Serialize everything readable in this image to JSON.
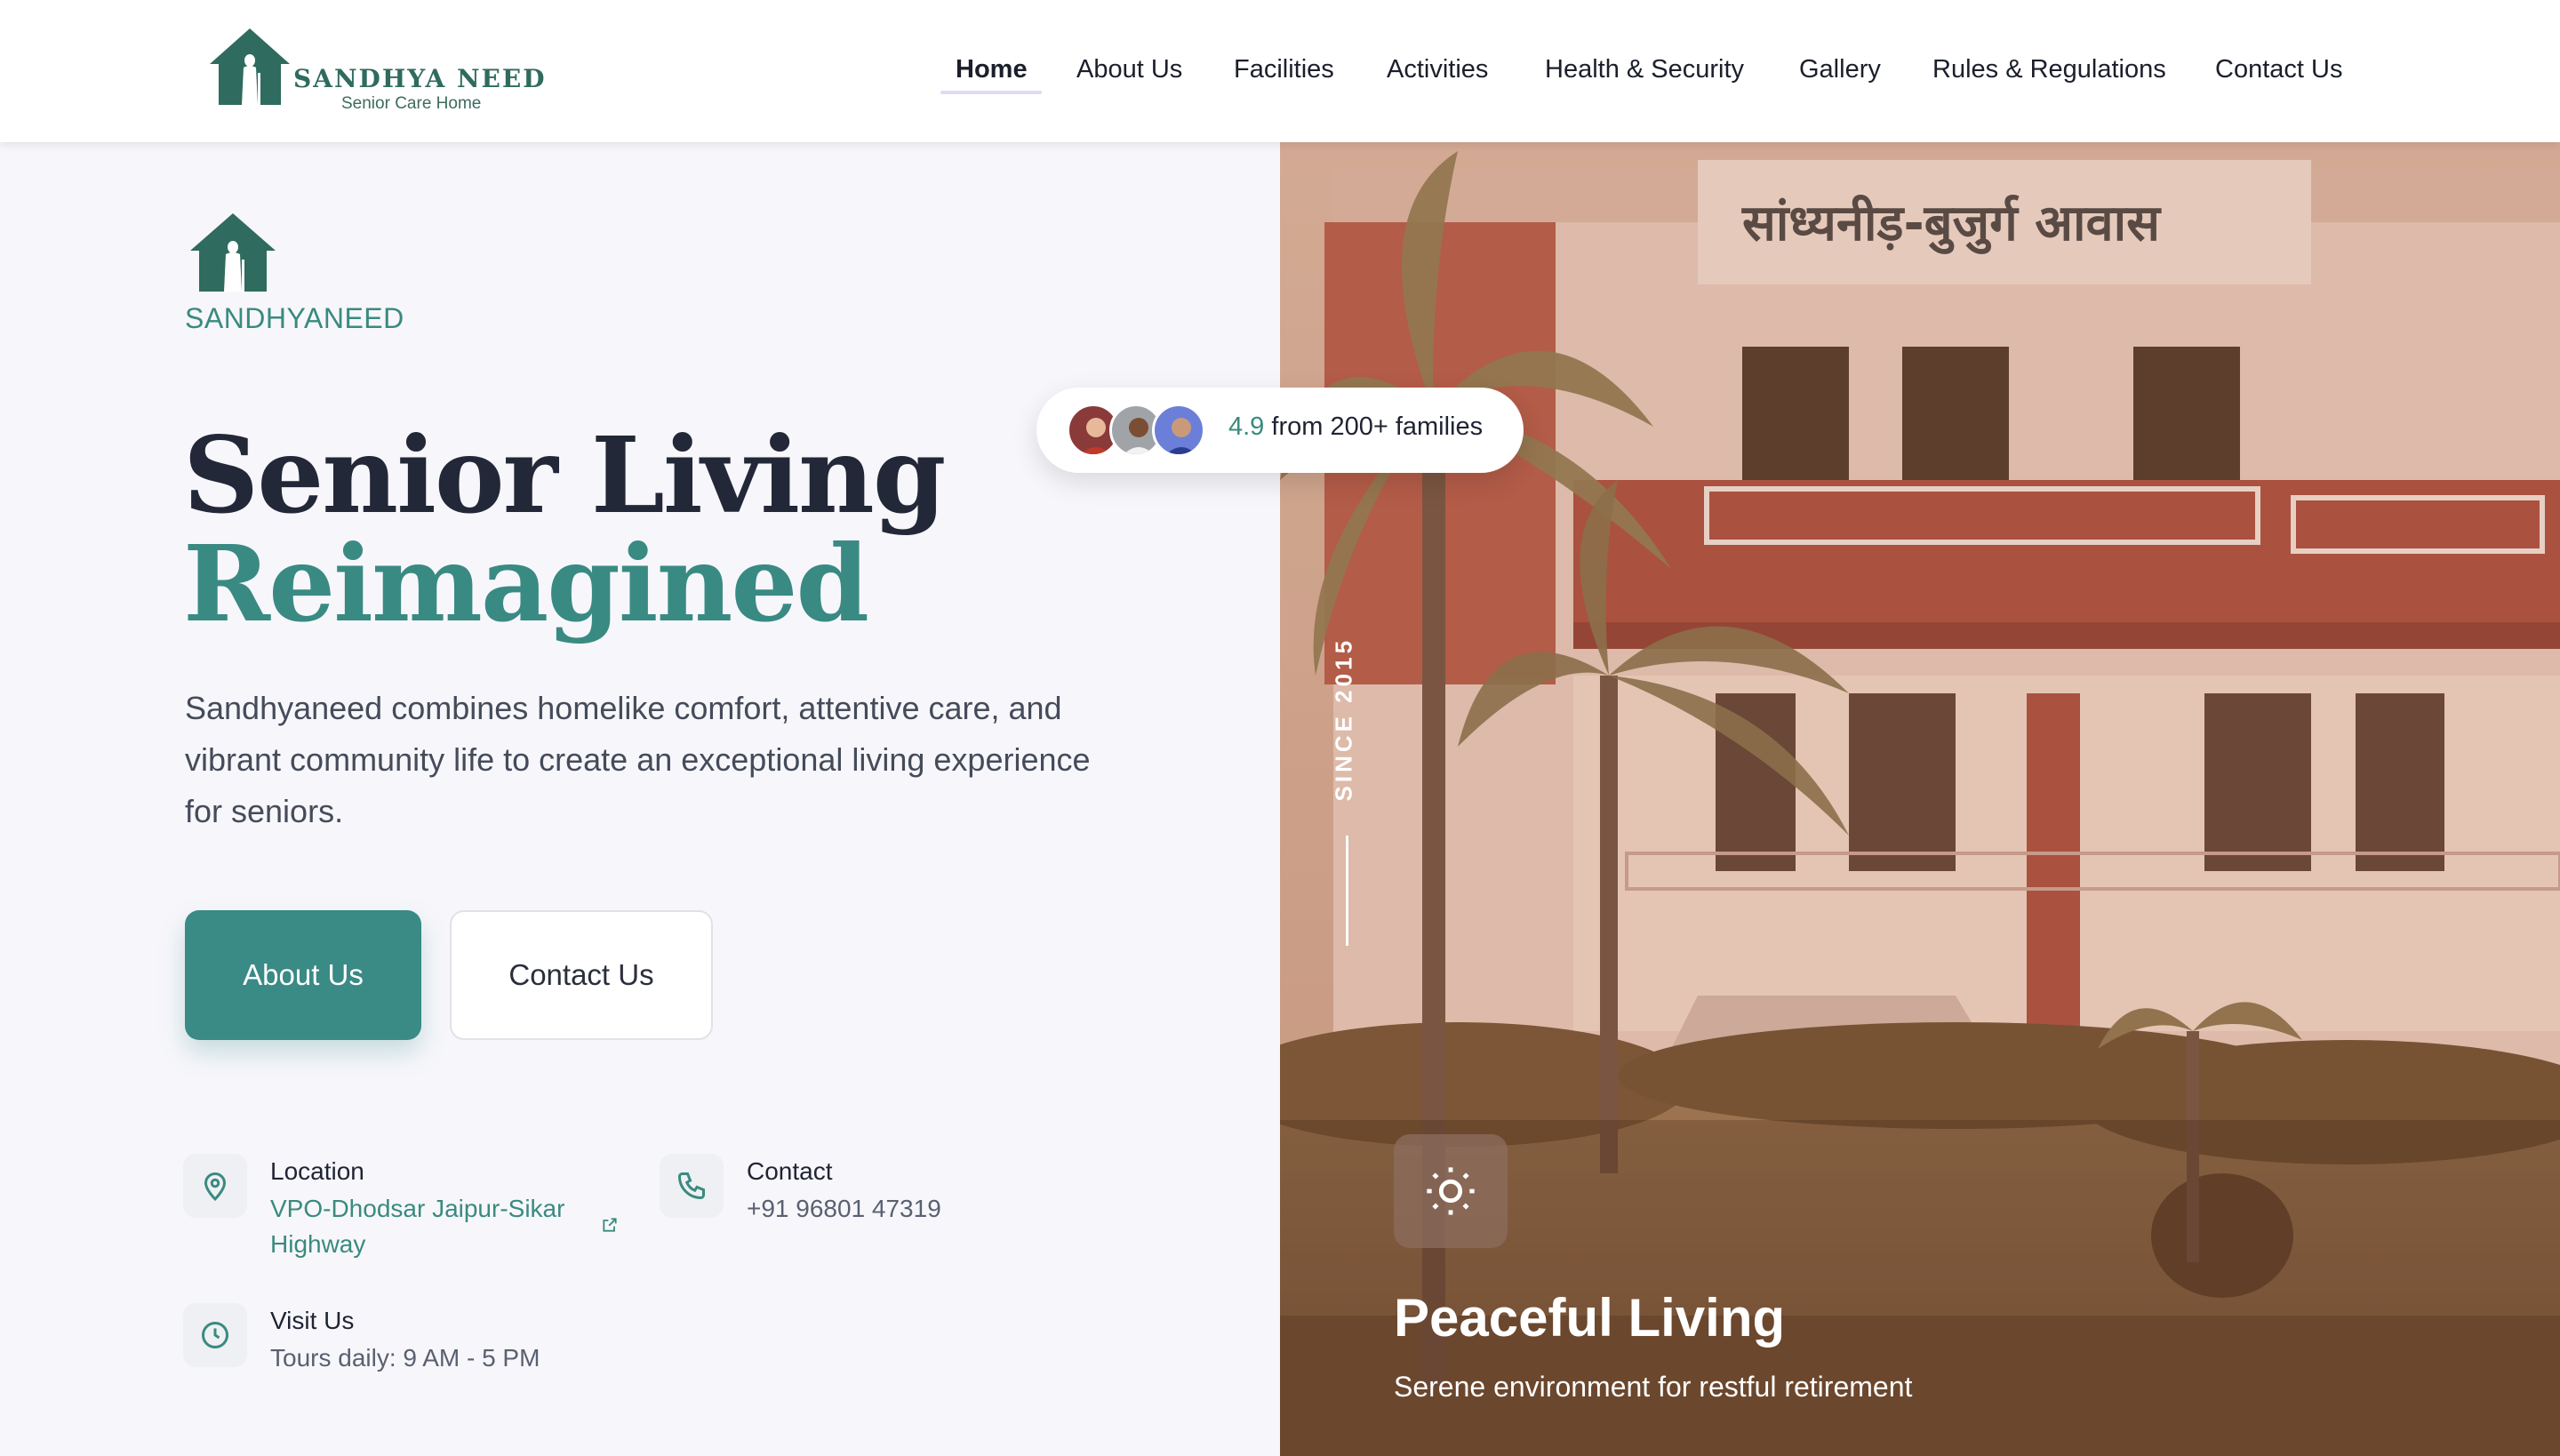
{
  "header": {
    "logo_name": "SANDHYA NEED",
    "logo_tagline": "Senior Care Home",
    "nav": [
      "Home",
      "About Us",
      "Facilities",
      "Activities",
      "Health & Security",
      "Gallery",
      "Rules & Regulations",
      "Contact Us"
    ],
    "active_nav": "Home"
  },
  "hero": {
    "brand": "SANDHYANEED",
    "title_line1": "Senior Living",
    "title_line2": "Reimagined",
    "description": "Sandhyaneed combines homelike comfort, attentive care, and vibrant community life to create an exceptional living experience for seniors.",
    "primary_button": "About Us",
    "secondary_button": "Contact Us"
  },
  "info": {
    "location_title": "Location",
    "location_value": "VPO-Dhodsar Jaipur-Sikar Highway",
    "contact_title": "Contact",
    "contact_value": "+91 96801 47319",
    "visit_title": "Visit Us",
    "visit_value": "Tours daily: 9 AM - 5 PM"
  },
  "rating": {
    "score": "4.9",
    "text": "from 200+ families"
  },
  "photo": {
    "building_sign": "सांध्यनीड़-बुजुर्ग आवास",
    "since": "SINCE 2015",
    "feature_title": "Peaceful Living",
    "feature_subtitle": "Serene environment for restful retirement"
  },
  "colors": {
    "accent": "#3a8a86",
    "brand_green": "#2f6b5e",
    "heading": "#232838"
  }
}
